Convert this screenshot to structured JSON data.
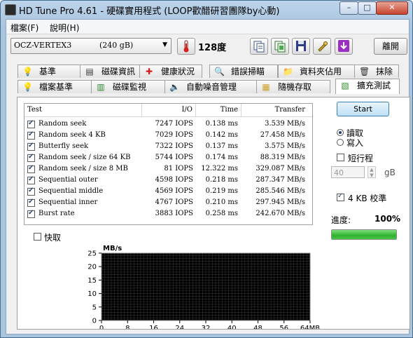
{
  "window": {
    "title": "HD Tune Pro 4.61 - 硬碟實用程式 (LOOP歡醋研習團隊by心動)",
    "min": "–",
    "max": "□",
    "close": "✕"
  },
  "menu": [
    "檔案(F)",
    "說明(H)"
  ],
  "toolbar": {
    "drive_name": "OCZ-VERTEX3",
    "drive_size": "(240 gB)",
    "temperature": "128度",
    "exit_label": "離開"
  },
  "tabs_top": [
    {
      "label": "基準",
      "icon": "lightbulb-icon",
      "glyph": "💡"
    },
    {
      "label": "磁碟資訊",
      "icon": "info-icon",
      "glyph": "▤"
    },
    {
      "label": "健康狀況",
      "icon": "health-cross-icon",
      "glyph": "✚"
    },
    {
      "label": "錯誤掃瞄",
      "icon": "scan-icon",
      "glyph": "🔍"
    },
    {
      "label": "資料夾佔用",
      "icon": "folder-icon",
      "glyph": "📁"
    },
    {
      "label": "抹除",
      "icon": "trash-icon",
      "glyph": "🗑"
    }
  ],
  "tabs_bottom": [
    {
      "label": "檔案基準",
      "icon": "file-benchmark-icon",
      "glyph": "💡"
    },
    {
      "label": "磁碟監視",
      "icon": "monitor-icon",
      "glyph": "▥"
    },
    {
      "label": "自動噪音管理",
      "icon": "speaker-icon",
      "glyph": "🔈"
    },
    {
      "label": "隨機存取",
      "icon": "random-access-icon",
      "glyph": "▦"
    },
    {
      "label": "擴充測試",
      "icon": "extra-tests-icon",
      "glyph": "▧"
    }
  ],
  "results": {
    "headers": {
      "test": "Test",
      "io": "I/O",
      "time": "Time",
      "transfer": "Transfer"
    },
    "rows": [
      {
        "test": "Random seek",
        "io": "7247 IOPS",
        "time": "0.138 ms",
        "transfer": "3.539 MB/s"
      },
      {
        "test": "Random seek 4 KB",
        "io": "7029 IOPS",
        "time": "0.142 ms",
        "transfer": "27.458 MB/s"
      },
      {
        "test": "Butterfly seek",
        "io": "7322 IOPS",
        "time": "0.137 ms",
        "transfer": "3.575 MB/s"
      },
      {
        "test": "Random seek / size 64 KB",
        "io": "5744 IOPS",
        "time": "0.174 ms",
        "transfer": "88.319 MB/s"
      },
      {
        "test": "Random seek / size 8 MB",
        "io": "81 IOPS",
        "time": "12.322 ms",
        "transfer": "329.087 MB/s"
      },
      {
        "test": "Sequential outer",
        "io": "4598 IOPS",
        "time": "0.218 ms",
        "transfer": "287.347 MB/s"
      },
      {
        "test": "Sequential middle",
        "io": "4569 IOPS",
        "time": "0.219 ms",
        "transfer": "285.546 MB/s"
      },
      {
        "test": "Sequential inner",
        "io": "4767 IOPS",
        "time": "0.210 ms",
        "transfer": "297.945 MB/s"
      },
      {
        "test": "Burst rate",
        "io": "3883 IOPS",
        "time": "0.258 ms",
        "transfer": "242.670 MB/s"
      }
    ]
  },
  "quick_label": "快取",
  "side": {
    "start_label": "Start",
    "read_label": "讀取",
    "write_label": "寫入",
    "short_stroke_label": "短行程",
    "length_value": "40",
    "length_unit": "gB",
    "align_label": "4 KB 校準",
    "progress_label": "進度:",
    "progress_value": "100%",
    "progress_fraction": 1.0
  },
  "chart_data": {
    "type": "line",
    "ylabel": "MB/s",
    "xlabel": "",
    "ylim": [
      0,
      25
    ],
    "xlim": [
      0,
      64
    ],
    "y_ticks": [
      "25",
      "20",
      "15",
      "10",
      "5",
      "0"
    ],
    "x_ticks": [
      "0",
      "8",
      "16",
      "24",
      "32",
      "40",
      "48",
      "56",
      "64MB"
    ],
    "grid": true,
    "series": []
  }
}
